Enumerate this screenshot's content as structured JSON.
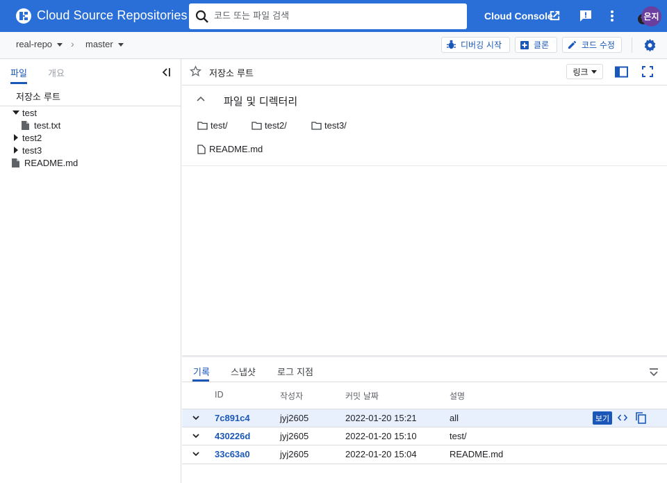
{
  "header": {
    "app_title": "Cloud Source Repositories",
    "search_placeholder": "코드 또는 파일 검색",
    "console_label": "Cloud Console",
    "avatar_text": "은지",
    "brand_color": "#2a6fd8"
  },
  "toolbar": {
    "repo": "real-repo",
    "branch": "master",
    "debug_label": "디버깅 시작",
    "clone_label": "클론",
    "edit_label": "코드 수정"
  },
  "sidebar": {
    "tabs": [
      {
        "label": "파일",
        "active": true
      },
      {
        "label": "개요",
        "active": false
      }
    ],
    "root_label": "저장소 루트",
    "tree": [
      {
        "name": "test",
        "type": "folder",
        "expanded": true
      },
      {
        "name": "test.txt",
        "type": "file"
      },
      {
        "name": "test2",
        "type": "folder",
        "expanded": false
      },
      {
        "name": "test3",
        "type": "folder",
        "expanded": false
      },
      {
        "name": "README.md",
        "type": "file"
      }
    ]
  },
  "main": {
    "title": "저장소 루트",
    "link_label": "링크",
    "files_heading": "파일 및 디렉터리",
    "folders": [
      "test/",
      "test2/",
      "test3/"
    ],
    "files": [
      "README.md"
    ]
  },
  "history": {
    "tabs": [
      {
        "label": "기록",
        "active": true
      },
      {
        "label": "스냅샷",
        "active": false
      },
      {
        "label": "로그 지점",
        "active": false
      }
    ],
    "columns": [
      "ID",
      "작성자",
      "커밋 날짜",
      "설명"
    ],
    "view_label": "보기",
    "rows": [
      {
        "id": "7c891c4",
        "author": "jyj2605",
        "date": "2022-01-20 15:21",
        "desc": "all",
        "highlighted": true
      },
      {
        "id": "430226d",
        "author": "jyj2605",
        "date": "2022-01-20 15:10",
        "desc": "test/",
        "highlighted": false
      },
      {
        "id": "33c63a0",
        "author": "jyj2605",
        "date": "2022-01-20 15:04",
        "desc": "README.md",
        "highlighted": false
      }
    ]
  }
}
